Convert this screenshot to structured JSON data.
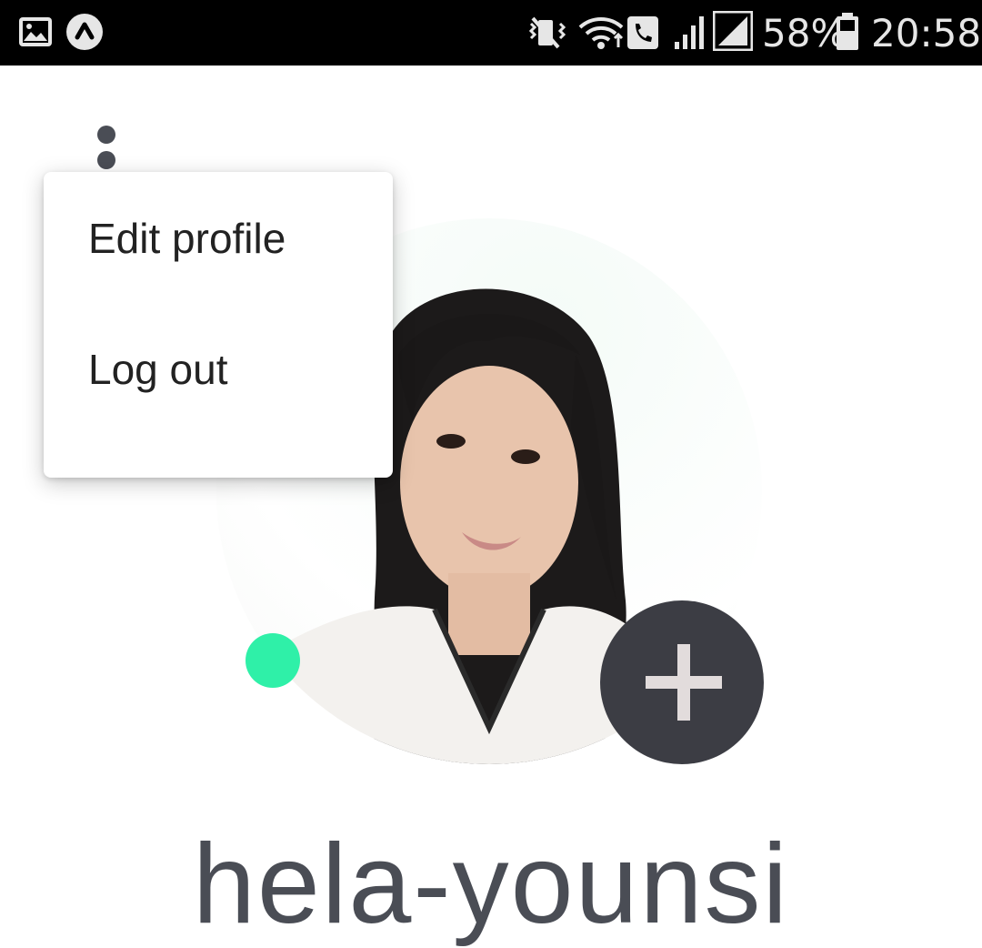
{
  "status_bar": {
    "battery_percent": "58%",
    "time": "20:58",
    "icons": [
      "image-icon",
      "app-notification-icon",
      "vibrate-icon",
      "wifi-icon",
      "wifi-call-icon",
      "signal-icon",
      "signal-full-icon",
      "battery-icon"
    ]
  },
  "header": {
    "menu_icon": "more-vertical-icon"
  },
  "menu": {
    "items": [
      {
        "label": "Edit profile"
      },
      {
        "label": "Log out"
      }
    ]
  },
  "profile": {
    "online_color": "#2ff0a8",
    "add_icon": "plus-icon",
    "username": "hela-younsi"
  }
}
